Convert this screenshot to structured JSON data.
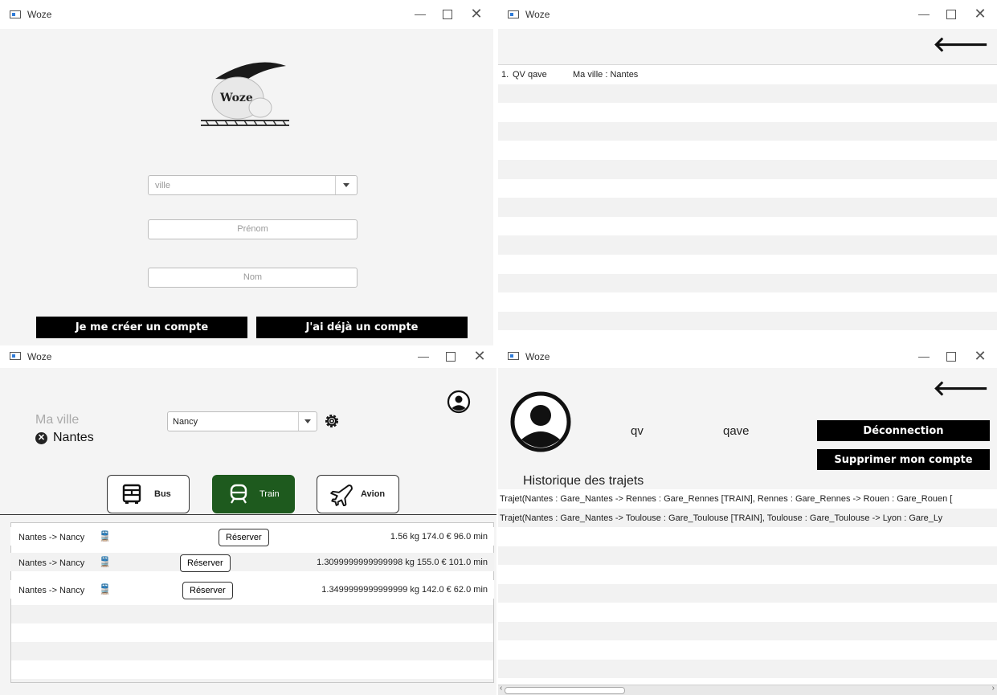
{
  "window_title": "Woze",
  "login": {
    "logo_text": "Woze",
    "city_placeholder": "ville",
    "firstname_placeholder": "Prénom",
    "lastname_placeholder": "Nom",
    "create_account_label": "Je me créer un compte",
    "have_account_label": "J'ai déjà un compte"
  },
  "history_list": {
    "items": [
      {
        "index": "1.",
        "user": "QV qave",
        "city": "Ma ville : Nantes"
      }
    ]
  },
  "search": {
    "my_city_label": "Ma ville",
    "my_city_value": "Nantes",
    "destination_value": "Nancy",
    "transports": [
      {
        "label": "Bus",
        "selected": false
      },
      {
        "label": "Train",
        "selected": true
      },
      {
        "label": "Avion",
        "selected": false
      }
    ],
    "results": [
      {
        "route": "Nantes -> Nancy",
        "button": "Réserver",
        "details": "1.56 kg 174.0 € 96.0 min"
      },
      {
        "route": "Nantes -> Nancy",
        "button": "Réserver",
        "details": "1.3099999999999998 kg 155.0 € 101.0 min"
      },
      {
        "route": "Nantes -> Nancy",
        "button": "Réserver",
        "details": "1.3499999999999999 kg 142.0 € 62.0 min"
      }
    ]
  },
  "profile": {
    "first_name": "qv",
    "last_name": "qave",
    "logout_label": "Déconnection",
    "delete_label": "Supprimer mon compte",
    "history_title": "Historique des trajets",
    "trips": [
      "Trajet(Nantes : Gare_Nantes -> Rennes : Gare_Rennes [TRAIN], Rennes : Gare_Rennes -> Rouen : Gare_Rouen [",
      "Trajet(Nantes : Gare_Nantes -> Toulouse : Gare_Toulouse [TRAIN], Toulouse : Gare_Toulouse -> Lyon : Gare_Ly"
    ]
  },
  "colors": {
    "accent_green": "#1e5a1e",
    "button_black": "#000000",
    "stripe": "#f2f2f2"
  }
}
